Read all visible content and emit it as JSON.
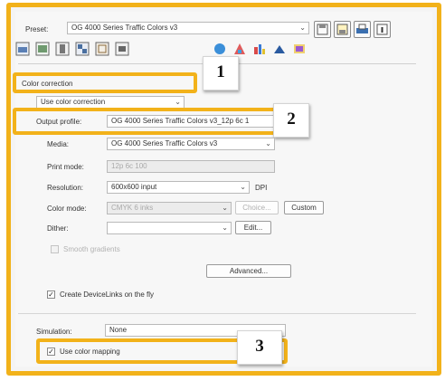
{
  "preset": {
    "label": "Preset:",
    "value": "OG 4000 Series Traffic Colors v3"
  },
  "toolbar_icons": [
    "save-preset-icon",
    "save-as-icon",
    "printer-icon",
    "info-icon"
  ],
  "tabs": [
    "tab-general",
    "tab-layout",
    "tab-media",
    "tab-color",
    "tab-quality",
    "tab-finishing",
    "tab-spot",
    "tab-profiles",
    "tab-rip",
    "tab-ink",
    "tab-misc"
  ],
  "color_correction": {
    "title": "Color correction",
    "mode": "Use color correction",
    "output_profile": {
      "label": "Output profile:",
      "value": "OG 4000 Series Traffic Colors v3_12p 6c 1"
    },
    "media": {
      "label": "Media:",
      "value": "OG 4000 Series Traffic Colors v3"
    },
    "print_mode": {
      "label": "Print mode:",
      "value": "12p 6c 100"
    },
    "resolution": {
      "label": "Resolution:",
      "value": "600x600 input",
      "unit": "DPI"
    },
    "color_mode": {
      "label": "Color mode:",
      "value": "CMYK 6 inks",
      "choice_button": "Choice...",
      "custom_button": "Custom"
    },
    "dither": {
      "label": "Dither:",
      "value": "",
      "edit_button": "Edit..."
    },
    "smooth_gradients": {
      "label": "Smooth gradients",
      "checked": false,
      "enabled": false
    },
    "advanced_button": "Advanced...",
    "create_devicelinks": {
      "label": "Create DeviceLinks on the fly",
      "checked": true
    }
  },
  "simulation": {
    "label": "Simulation:",
    "value": "None"
  },
  "use_color_mapping": {
    "label": "Use color mapping",
    "checked": true
  },
  "callouts": [
    "1",
    "2",
    "3"
  ],
  "colors": {
    "highlight": "#f2b21a",
    "panel": "#f7f7f7"
  }
}
